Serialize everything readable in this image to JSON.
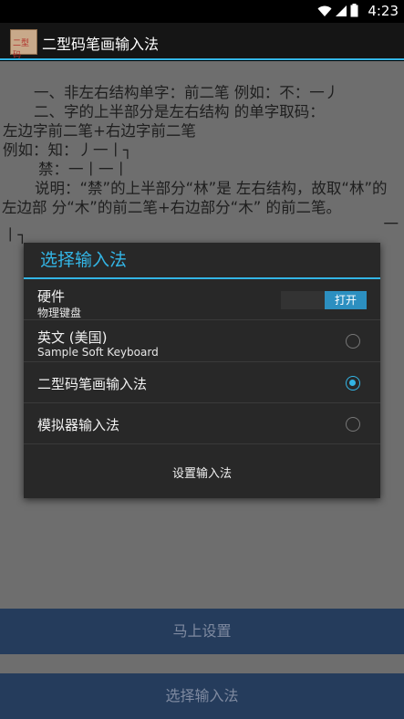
{
  "status_bar": {
    "time": "4:23"
  },
  "app": {
    "icon_text": "二型码",
    "title": "二型码笔画输入法"
  },
  "document": {
    "lines": [
      "一、非左右结构单字：前二笔 例如：不：一丿",
      "二、字的上半部分是左右结构 的单字取码：",
      "左边字前二笔+右边字前二笔",
      "例如：知：丿一丨┐",
      "禁：一丨一丨",
      "说明：“禁”的上半部分“林”是 左右结构，故取“林”的左边部 分“木”的前二笔+右边部分“木” 的前二笔。"
    ],
    "fragment": "丨┐",
    "fragment_right": "一"
  },
  "buttons": {
    "setup_now": "马上设置",
    "choose_input_method": "选择输入法"
  },
  "dialog": {
    "title": "选择输入法",
    "hardware": {
      "label": "硬件",
      "sub": "物理键盘",
      "toggle": "打开"
    },
    "options": [
      {
        "label": "英文 (美国)",
        "sub": "Sample Soft Keyboard",
        "selected": false
      },
      {
        "label": "二型码笔画输入法",
        "sub": "",
        "selected": true
      },
      {
        "label": "模拟器输入法",
        "sub": "",
        "selected": false
      }
    ],
    "footer": "设置输入法"
  },
  "colors": {
    "accent": "#33b5e5",
    "button_bg": "#253c5c",
    "dialog_bg": "#282828"
  }
}
